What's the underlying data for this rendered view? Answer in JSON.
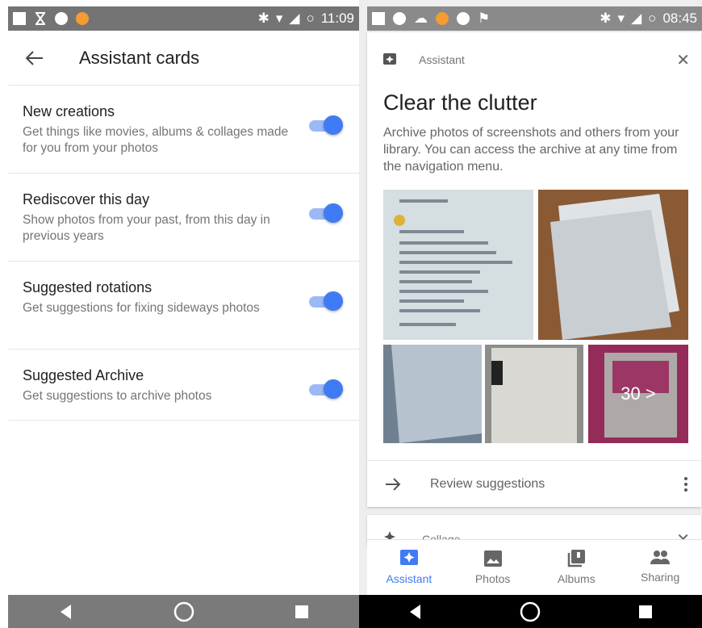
{
  "left": {
    "status_time": "11:09",
    "appbar_title": "Assistant cards",
    "settings": [
      {
        "title": "New creations",
        "desc": "Get things like movies, albums & collages made for you from your photos",
        "enabled": true
      },
      {
        "title": "Rediscover this day",
        "desc": "Show photos from your past, from this day in previous years",
        "enabled": true
      },
      {
        "title": "Suggested rotations",
        "desc": "Get suggestions for fixing sideways photos",
        "enabled": true
      },
      {
        "title": "Suggested Archive",
        "desc": "Get suggestions to archive photos",
        "enabled": true
      }
    ]
  },
  "right": {
    "status_time": "08:45",
    "card": {
      "label": "Assistant",
      "title": "Clear the clutter",
      "body": "Archive photos of screenshots and others from your library. You can access the archive at any time from the navigation menu.",
      "more_count": "30 >",
      "action": "Review suggestions"
    },
    "card2": {
      "label": "Collage"
    },
    "bottom_nav": [
      {
        "label": "Assistant",
        "icon": "assistant-icon",
        "active": true
      },
      {
        "label": "Photos",
        "icon": "photos-icon",
        "active": false
      },
      {
        "label": "Albums",
        "icon": "albums-icon",
        "active": false
      },
      {
        "label": "Sharing",
        "icon": "sharing-icon",
        "active": false
      }
    ]
  },
  "colors": {
    "accent": "#3f7bf5",
    "toggle_track": "#9cb8f5"
  }
}
